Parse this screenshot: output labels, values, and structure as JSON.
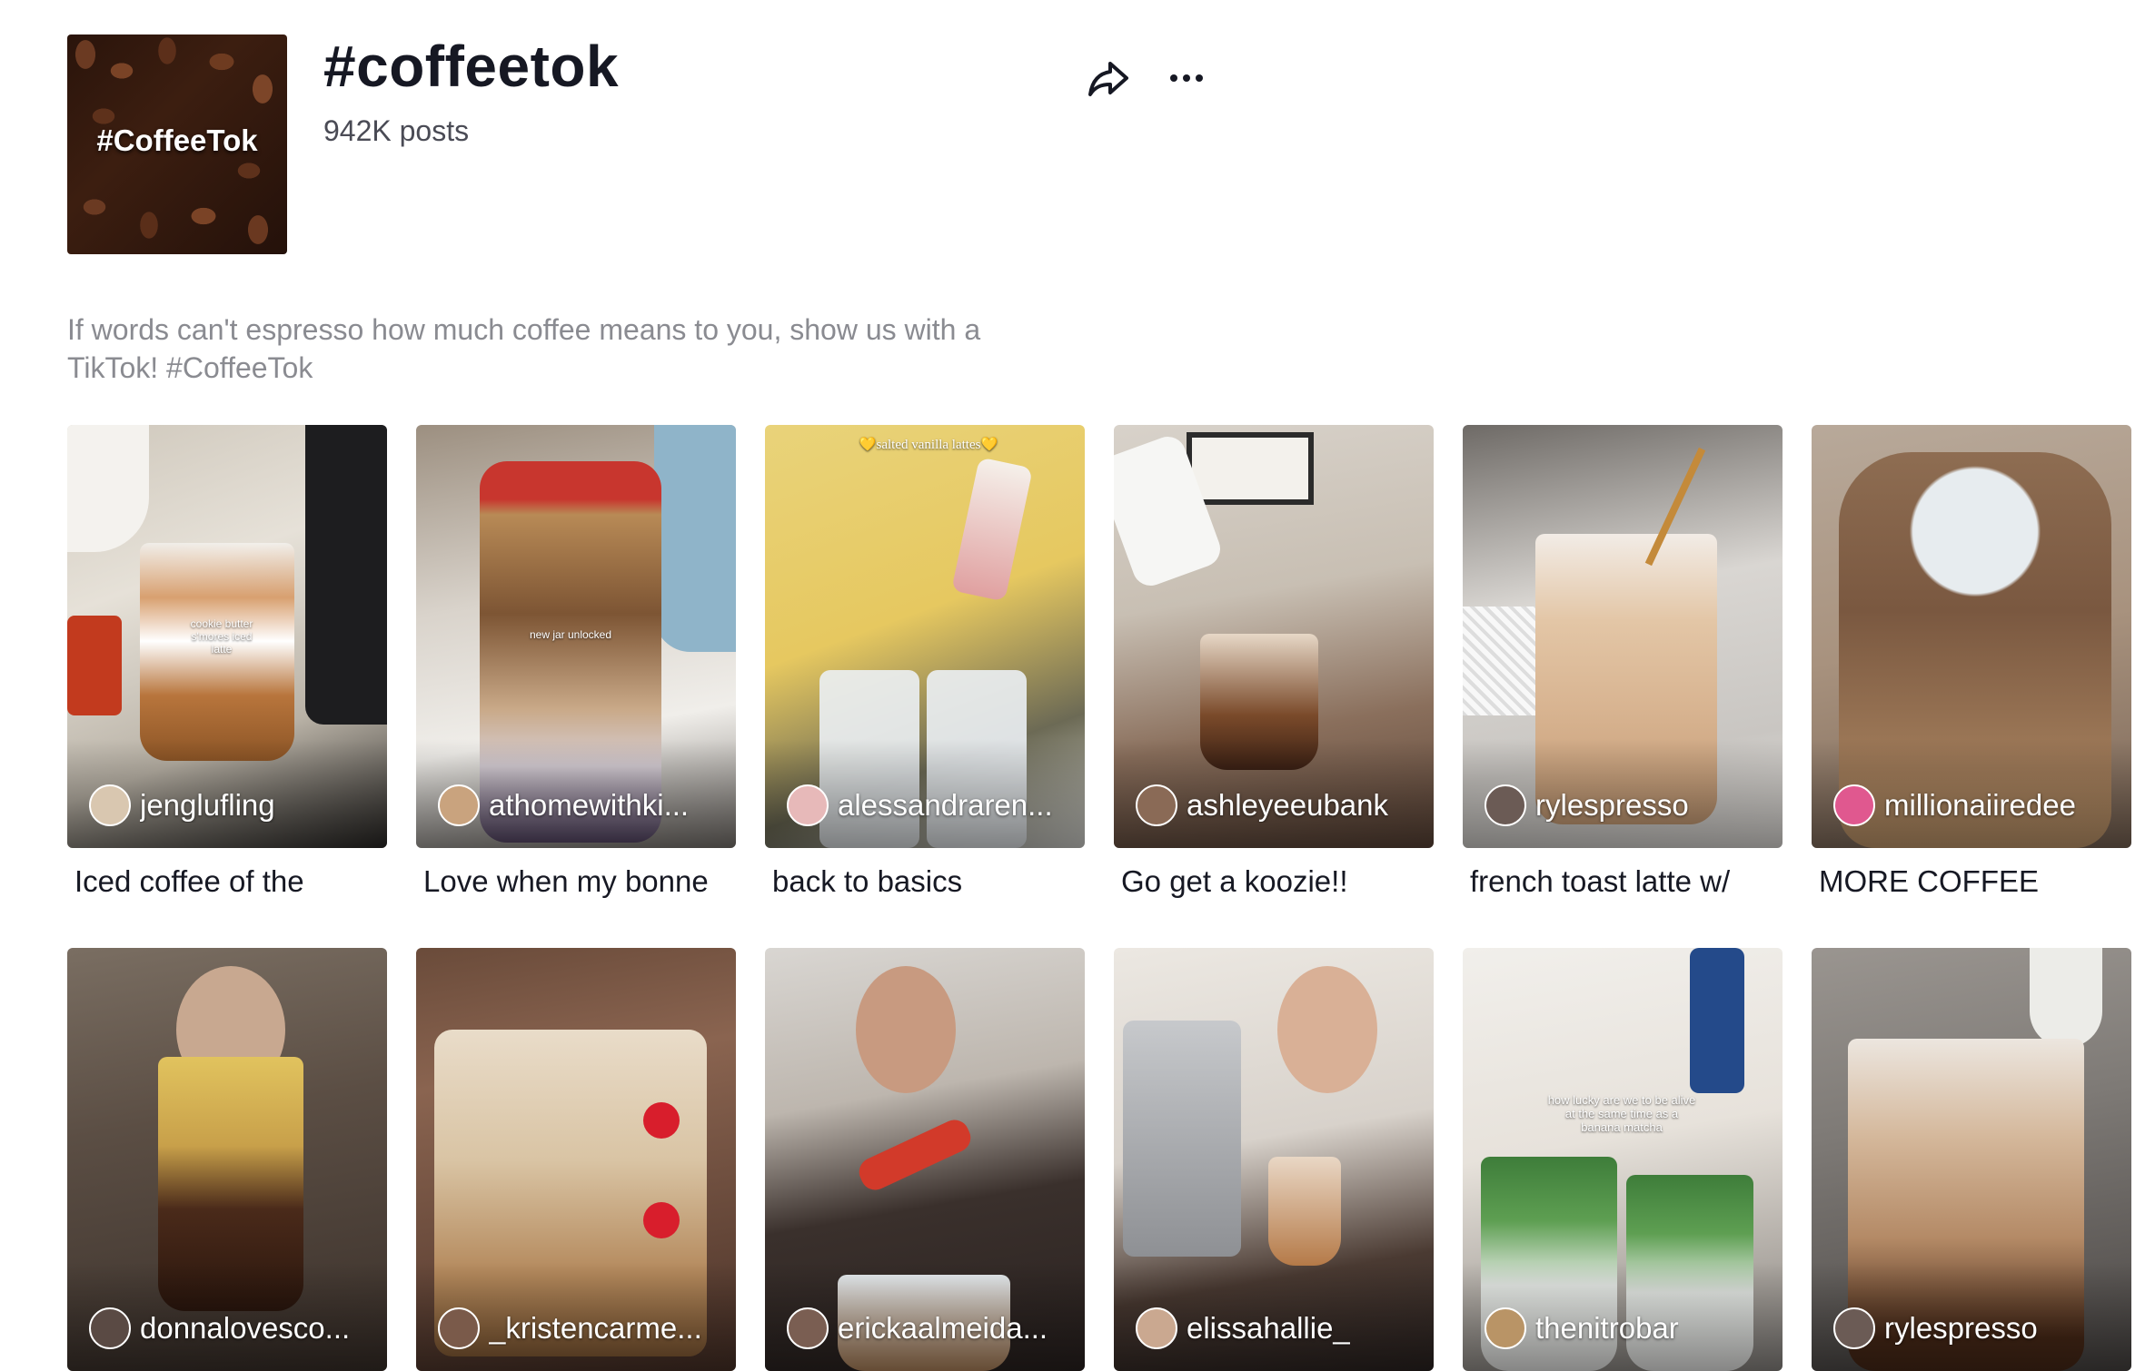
{
  "header": {
    "cover_text": "#CoffeeTok",
    "title": "#coffeetok",
    "post_count": "942K posts",
    "share_icon": "share-arrow-icon",
    "more_icon": "ellipsis-icon"
  },
  "description": "If words can't espresso how much coffee means to you, show us with a TikTok! #CoffeeTok",
  "videos": [
    {
      "username": "jenglufling",
      "caption": "Iced coffee of the",
      "overlay": "cookie butter s'mores iced latte"
    },
    {
      "username": "athomewithki...",
      "caption": "Love when my bonne",
      "overlay": "new jar unlocked"
    },
    {
      "username": "alessandraren...",
      "caption": "back to basics",
      "overlay": "💛salted vanilla lattes💛"
    },
    {
      "username": "ashleyeeubank",
      "caption": "Go get a koozie!!",
      "overlay": ""
    },
    {
      "username": "rylespresso",
      "caption": "french toast latte w/",
      "overlay": ""
    },
    {
      "username": "millionaiiredee",
      "caption": "MORE COFFEE",
      "overlay": ""
    },
    {
      "username": "donnalovesco...",
      "caption": "",
      "overlay": ""
    },
    {
      "username": "_kristencarme...",
      "caption": "",
      "overlay": ""
    },
    {
      "username": "erickaalmeida...",
      "caption": "",
      "overlay": ""
    },
    {
      "username": "elissahallie_",
      "caption": "",
      "overlay": ""
    },
    {
      "username": "thenitrobar",
      "caption": "",
      "overlay": "how lucky are we to be alive at the same time as a banana matcha"
    },
    {
      "username": "rylespresso",
      "caption": "",
      "overlay": ""
    }
  ],
  "colors": {
    "text_primary": "#161823",
    "text_secondary": "#8a8b91"
  }
}
